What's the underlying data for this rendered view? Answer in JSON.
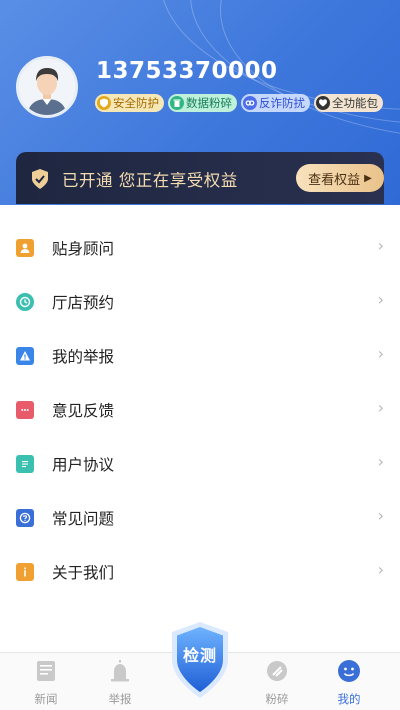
{
  "profile": {
    "phone": "13753370000",
    "badges": [
      {
        "label": "安全防护",
        "icon": "shield-icon"
      },
      {
        "label": "数据粉碎",
        "icon": "trash-icon"
      },
      {
        "label": "反诈防扰",
        "icon": "link-icon"
      },
      {
        "label": "全功能包",
        "icon": "heart-shield-icon"
      }
    ]
  },
  "vip": {
    "status_text": "已开通 您正在享受权益",
    "button_label": "查看权益"
  },
  "menu": {
    "items": [
      {
        "label": "贴身顾问",
        "icon": "advisor-icon",
        "color": "#f0a030"
      },
      {
        "label": "厅店预约",
        "icon": "clock-icon",
        "color": "#3bbfb0"
      },
      {
        "label": "我的举报",
        "icon": "warning-icon",
        "color": "#3a86e8"
      },
      {
        "label": "意见反馈",
        "icon": "feedback-icon",
        "color": "#e85b6a"
      },
      {
        "label": "用户协议",
        "icon": "document-icon",
        "color": "#3bbfb0"
      },
      {
        "label": "常见问题",
        "icon": "question-icon",
        "color": "#3a6fd8"
      },
      {
        "label": "关于我们",
        "icon": "info-icon",
        "color": "#f0a030"
      }
    ]
  },
  "bottom_nav": {
    "items": [
      {
        "label": "新闻",
        "icon": "news-icon"
      },
      {
        "label": "举报",
        "icon": "alarm-icon"
      },
      {
        "label": "粉碎",
        "icon": "shred-icon"
      },
      {
        "label": "我的",
        "icon": "profile-face-icon",
        "active": true
      }
    ],
    "center_label": "检测"
  },
  "colors": {
    "header_blue": "#3f78dc",
    "vip_dark": "#1e2640",
    "vip_gold": "#e9c28a",
    "active_tab": "#3a6fd8"
  }
}
